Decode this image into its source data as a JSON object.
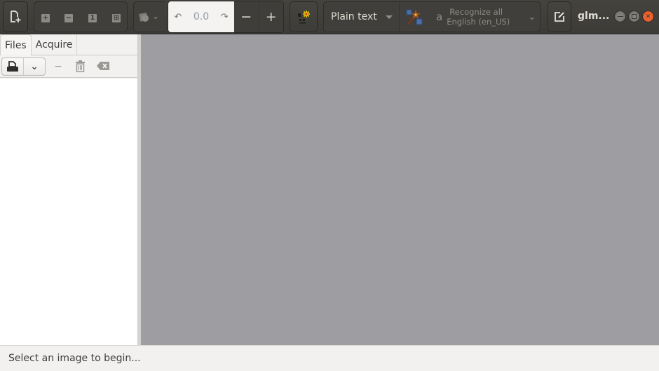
{
  "window": {
    "title": "glm...",
    "controls": [
      "minimize",
      "maximize",
      "close"
    ]
  },
  "toolbar": {
    "new_document_icon": "document-add-icon",
    "zoom_group": [
      {
        "name": "zoom-in",
        "glyph": "+"
      },
      {
        "name": "zoom-out",
        "glyph": "−"
      },
      {
        "name": "zoom-one",
        "glyph": "1"
      },
      {
        "name": "zoom-fit",
        "glyph": "⊞"
      }
    ],
    "image_controls_icon": "image-controls-icon",
    "rotation": {
      "rotate_left_glyph": "↶",
      "value": "0.0",
      "rotate_right_glyph": "↷",
      "zoom_out_glyph": "−",
      "zoom_in_glyph": "+"
    },
    "autodetect_icon": "autodetect-layout-icon",
    "output_format": "Plain text",
    "recognize_icon": "magic-wand-icon",
    "language_line1": "Recognize all",
    "language_line2": "English (en_US)",
    "edit_output_icon": "edit-icon"
  },
  "left_panel": {
    "tabs": [
      {
        "label": "Files",
        "active": true
      },
      {
        "label": "Acquire",
        "active": false
      }
    ],
    "tools": {
      "add_icon": "scanner-add-icon",
      "remove_glyph": "−",
      "delete_glyph": "🗑",
      "clear_glyph": "⌫"
    }
  },
  "status": {
    "text": "Select an image to begin..."
  },
  "colors": {
    "header_bg": "#3c3b37",
    "canvas_bg": "#9e9da1",
    "close_button": "#e95420"
  }
}
